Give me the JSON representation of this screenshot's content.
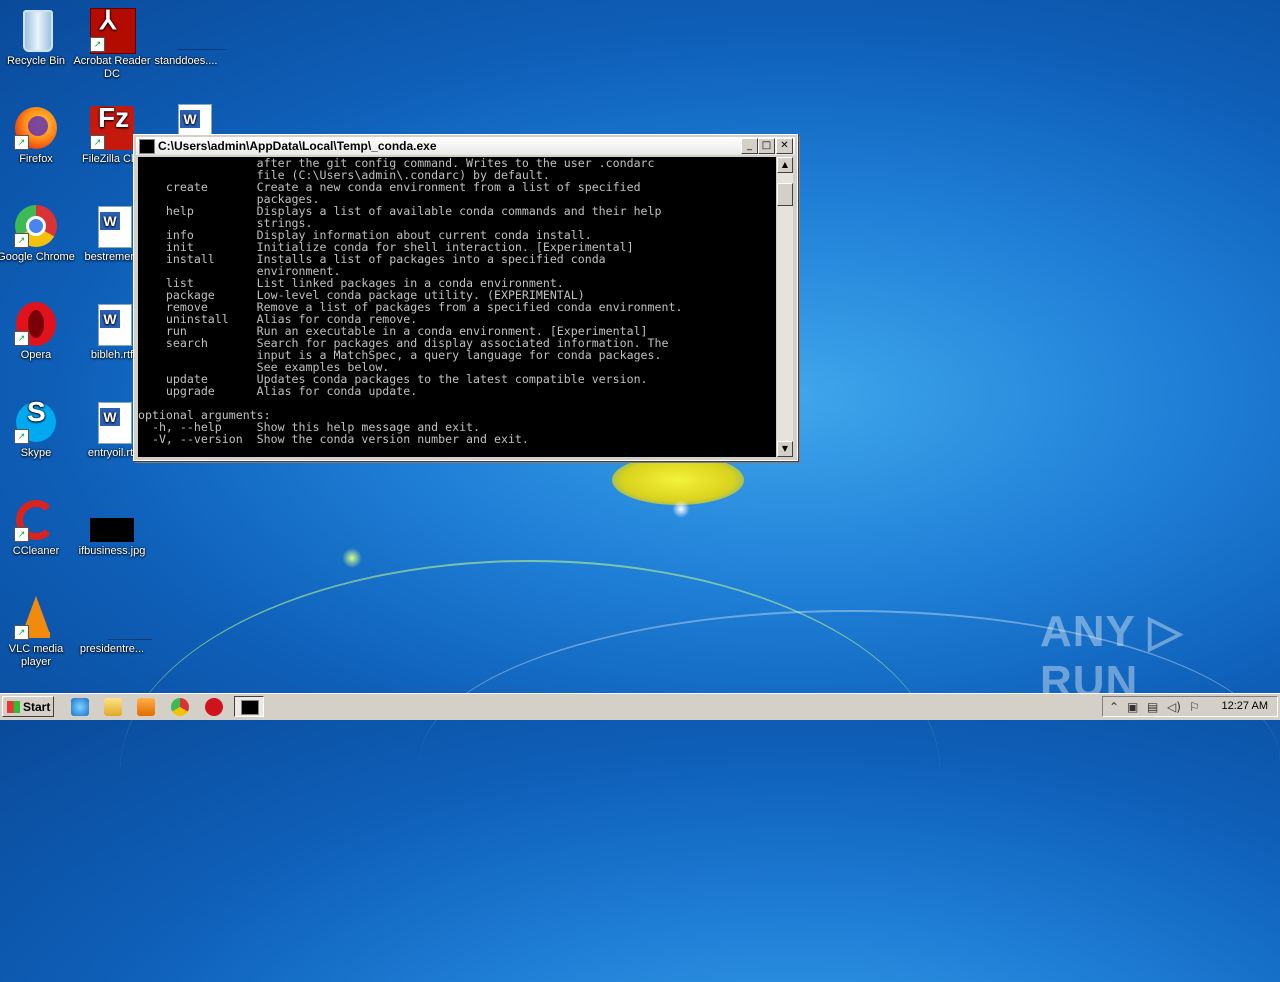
{
  "desktop": {
    "icons": [
      {
        "label": "Recycle Bin"
      },
      {
        "label": "Acrobat Reader DC"
      },
      {
        "label": "standdoes...."
      },
      {
        "label": "Firefox"
      },
      {
        "label": "FileZilla Clie"
      },
      {
        "label": "Google Chrome"
      },
      {
        "label": "bestremem"
      },
      {
        "label": "Opera"
      },
      {
        "label": "bibleh.rtf"
      },
      {
        "label": "Skype"
      },
      {
        "label": "entryoil.rtf"
      },
      {
        "label": "CCleaner"
      },
      {
        "label": "ifbusiness.jpg"
      },
      {
        "label": "VLC media player"
      },
      {
        "label": "presidentre..."
      }
    ]
  },
  "console": {
    "title": "C:\\Users\\admin\\AppData\\Local\\Temp\\_conda.exe",
    "minimize": "_",
    "restore": "□",
    "close": "✕",
    "text": "                 after the git config command. Writes to the user .condarc\n                 file (C:\\Users\\admin\\.condarc) by default.\n    create       Create a new conda environment from a list of specified\n                 packages.\n    help         Displays a list of available conda commands and their help\n                 strings.\n    info         Display information about current conda install.\n    init         Initialize conda for shell interaction. [Experimental]\n    install      Installs a list of packages into a specified conda\n                 environment.\n    list         List linked packages in a conda environment.\n    package      Low-level conda package utility. (EXPERIMENTAL)\n    remove       Remove a list of packages from a specified conda environment.\n    uninstall    Alias for conda remove.\n    run          Run an executable in a conda environment. [Experimental]\n    search       Search for packages and display associated information. The\n                 input is a MatchSpec, a query language for conda packages.\n                 See examples below.\n    update       Updates conda packages to the latest compatible version.\n    upgrade      Alias for conda update.\n\noptional arguments:\n  -h, --help     Show this help message and exit.\n  -V, --version  Show the conda version number and exit."
  },
  "taskbar": {
    "start_label": "Start",
    "clock": "12:27 AM"
  },
  "watermark": "ANY ▷ RUN",
  "colors": {
    "desktop_blue": "#1f7fd6",
    "console_bg": "#000000",
    "console_text": "#c0c0c0",
    "window_chrome": "#d4d0c8"
  }
}
